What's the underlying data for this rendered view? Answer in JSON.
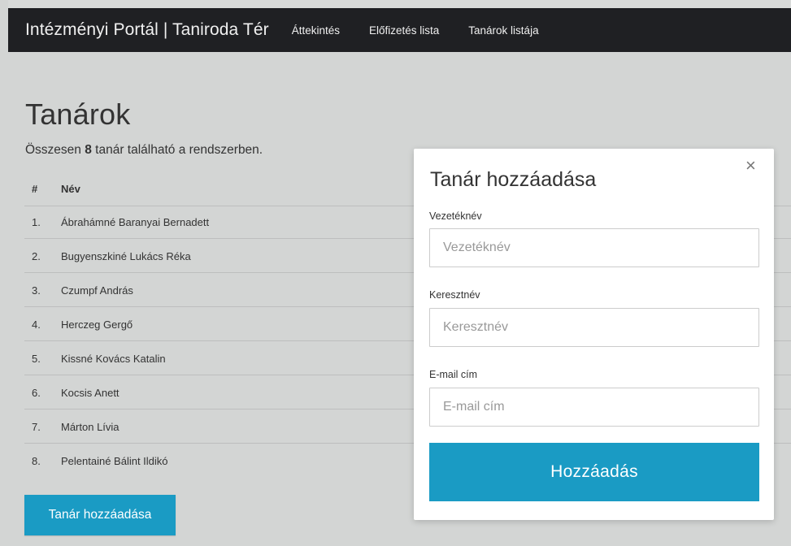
{
  "navbar": {
    "brand": "Intézményi Portál | Taniroda Tér",
    "links": [
      "Áttekintés",
      "Előfizetés lista",
      "Tanárok listája"
    ]
  },
  "page": {
    "title": "Tanárok",
    "summary_prefix": "Összesen ",
    "summary_count": "8",
    "summary_suffix": " tanár található a rendszerben."
  },
  "table": {
    "headers": {
      "num": "#",
      "name": "Név"
    },
    "rows": [
      {
        "num": "1.",
        "name": "Ábrahámné Baranyai Bernadett"
      },
      {
        "num": "2.",
        "name": "Bugyenszkiné Lukács Réka"
      },
      {
        "num": "3.",
        "name": "Czumpf András"
      },
      {
        "num": "4.",
        "name": "Herczeg Gergő"
      },
      {
        "num": "5.",
        "name": "Kissné Kovács Katalin"
      },
      {
        "num": "6.",
        "name": "Kocsis Anett"
      },
      {
        "num": "7.",
        "name": "Márton Lívia"
      },
      {
        "num": "8.",
        "name": "Pelentainé Bálint Ildikó"
      }
    ]
  },
  "add_button_label": "Tanár hozzáadása",
  "modal": {
    "title": "Tanár hozzáadása",
    "close_glyph": "×",
    "close_icon": "close-icon",
    "fields": {
      "last_name": {
        "label": "Vezetéknév",
        "placeholder": "Vezetéknév",
        "value": ""
      },
      "first_name": {
        "label": "Keresztnév",
        "placeholder": "Keresztnév",
        "value": ""
      },
      "email": {
        "label": "E-mail cím",
        "placeholder": "E-mail cím",
        "value": ""
      }
    },
    "submit_label": "Hozzáadás"
  },
  "colors": {
    "accent": "#1a9bc4",
    "navbar_bg": "#1f2023",
    "page_bg": "#d3d5d4"
  }
}
